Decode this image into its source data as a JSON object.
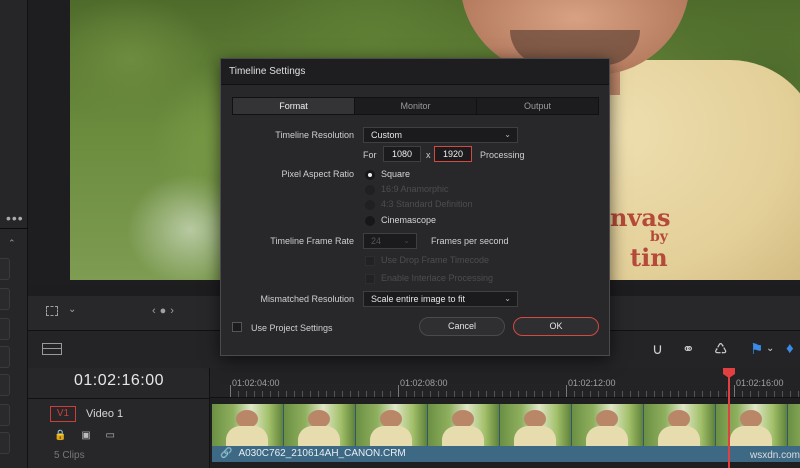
{
  "dialog": {
    "title": "Timeline Settings",
    "tabs": [
      {
        "label": "Format",
        "active": true
      },
      {
        "label": "Monitor",
        "active": false
      },
      {
        "label": "Output",
        "active": false
      }
    ],
    "timeline_resolution": {
      "label": "Timeline Resolution",
      "value": "Custom"
    },
    "for_label": "For",
    "width": "1080",
    "x_label": "x",
    "height": "1920",
    "processing_label": "Processing",
    "pixel_aspect_ratio": {
      "label": "Pixel Aspect Ratio",
      "options": [
        {
          "label": "Square",
          "selected": true,
          "enabled": true
        },
        {
          "label": "16:9 Anamorphic",
          "selected": false,
          "enabled": false
        },
        {
          "label": "4:3 Standard Definition",
          "selected": false,
          "enabled": false
        },
        {
          "label": "Cinemascope",
          "selected": false,
          "enabled": true
        }
      ]
    },
    "frame_rate": {
      "label": "Timeline Frame Rate",
      "value": "24",
      "unit": "Frames per second"
    },
    "drop_frame": "Use Drop Frame Timecode",
    "interlace": "Enable Interlace Processing",
    "mismatched": {
      "label": "Mismatched Resolution",
      "value": "Scale entire image to fit"
    },
    "use_project_settings": "Use Project Settings",
    "cancel": "Cancel",
    "ok": "OK"
  },
  "timeline": {
    "timecode": "01:02:16:00",
    "track_badge": "V1",
    "track_name": "Video 1",
    "clip_count": "5 Clips",
    "ruler_labels": [
      "01:02:04:00",
      "01:02:08:00",
      "01:02:12:00",
      "01:02:16:00"
    ],
    "clip_name": "A030C762_210614AH_CANON.CRM",
    "watermark": "wsxdn.com"
  },
  "viewer": {
    "shirt_text": [
      "nvas",
      "by",
      "tin"
    ]
  },
  "colors": {
    "accent_red": "#d44a42",
    "clip_blue": "#3e6985",
    "flag_blue": "#3a8be6"
  }
}
